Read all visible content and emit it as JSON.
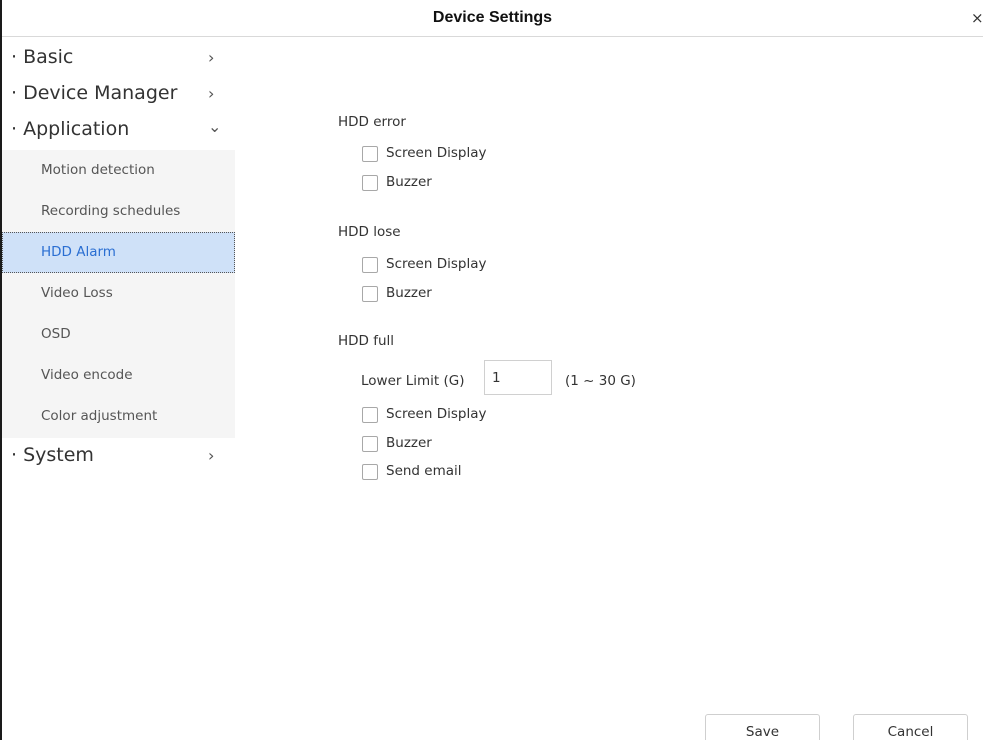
{
  "window": {
    "title": "Device Settings",
    "close_glyph": "×"
  },
  "sidebar": {
    "sections": [
      {
        "label": "· Basic",
        "chevron": "›"
      },
      {
        "label": "· Device Manager",
        "chevron": "›"
      },
      {
        "label": "· Application",
        "chevron": "⌄"
      },
      {
        "label": "· System",
        "chevron": "›"
      }
    ],
    "application_items": [
      {
        "label": "Motion detection"
      },
      {
        "label": "Recording schedules"
      },
      {
        "label": "HDD Alarm",
        "active": true
      },
      {
        "label": "Video Loss"
      },
      {
        "label": "OSD"
      },
      {
        "label": "Video encode"
      },
      {
        "label": "Color adjustment"
      }
    ]
  },
  "hdd_error": {
    "title": "HDD error",
    "screen_display": {
      "label": "Screen Display",
      "checked": false
    },
    "buzzer": {
      "label": "Buzzer",
      "checked": false
    }
  },
  "hdd_lose": {
    "title": "HDD lose",
    "screen_display": {
      "label": "Screen Display",
      "checked": false
    },
    "buzzer": {
      "label": "Buzzer",
      "checked": false
    }
  },
  "hdd_full": {
    "title": "HDD full",
    "lower_limit_label": "Lower Limit (G)",
    "lower_limit_value": "1",
    "lower_limit_range": "(1 ~ 30 G)",
    "screen_display": {
      "label": "Screen Display",
      "checked": false
    },
    "buzzer": {
      "label": "Buzzer",
      "checked": false
    },
    "send_email": {
      "label": "Send email",
      "checked": false
    }
  },
  "actions": {
    "save_label": "Save",
    "cancel_label": "Cancel"
  },
  "colors": {
    "active_item_bg": "#cfe1f8",
    "active_item_text": "#2a6ed2",
    "submenu_bg": "#f5f5f5"
  }
}
